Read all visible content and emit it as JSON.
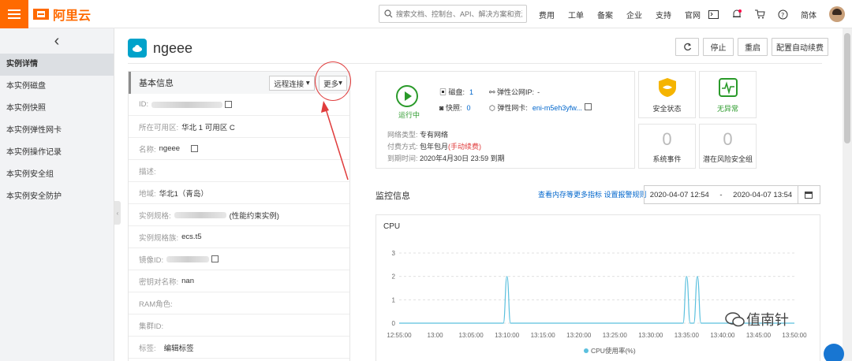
{
  "topbar": {
    "logo_text": "阿里云",
    "search_placeholder": "搜索文档、控制台、API、解决方案和资源",
    "nav": [
      "费用",
      "工单",
      "备案",
      "企业",
      "支持",
      "官网"
    ],
    "lang": "简体",
    "brand_color": "#ff6a00"
  },
  "sidebar": {
    "items": [
      "实例详情",
      "本实例磁盘",
      "本实例快照",
      "本实例弹性网卡",
      "本实例操作记录",
      "本实例安全组",
      "本实例安全防护"
    ]
  },
  "header": {
    "instance_name": "ngeee",
    "buttons": [
      "停止",
      "重启",
      "配置自动续费"
    ]
  },
  "basic": {
    "title": "基本信息",
    "remote_btn": "远程连接",
    "more_btn": "更多",
    "rows": [
      {
        "k": "ID:",
        "v": ""
      },
      {
        "k": "所在可用区:",
        "v": "华北 1 可用区 C"
      },
      {
        "k": "名称:",
        "v": "ngeee"
      },
      {
        "k": "描述:",
        "v": ""
      },
      {
        "k": "地域:",
        "v": "华北1（青岛）"
      },
      {
        "k": "实例规格:",
        "v": "(性能约束实例)"
      },
      {
        "k": "实例规格族:",
        "v": "ecs.t5"
      },
      {
        "k": "镜像ID:",
        "v": ""
      },
      {
        "k": "密钥对名称:",
        "v": "nan"
      },
      {
        "k": "RAM角色:",
        "v": ""
      },
      {
        "k": "集群ID:",
        "v": ""
      },
      {
        "k": "标签:",
        "v": "编辑标签"
      }
    ]
  },
  "status": {
    "running": "运行中",
    "disk_label": "磁盘:",
    "disk_count": "1",
    "snapshot_label": "快照:",
    "snapshot_count": "0",
    "eip_label": "弹性公网IP:",
    "eip_value": "-",
    "eni_label": "弹性网卡:",
    "eni_value": "eni-m5eh3yfw...",
    "net_type_k": "网络类型:",
    "net_type_v": "专有网络",
    "pay_k": "付费方式:",
    "pay_v": "包年包月",
    "pay_note": "(手动续费)",
    "expire_k": "到期时间:",
    "expire_v": "2020年4月30日 23:59 到期"
  },
  "cards": {
    "security": "安全状态",
    "abnormal": "无异常",
    "events_count": "0",
    "events_label": "系统事件",
    "risk_count": "0",
    "risk_label": "潜在风险安全组"
  },
  "monitor": {
    "title": "监控信息",
    "link1": "查看内存等更多指标",
    "link2": "设置报警规则",
    "start": "2020-04-07 12:54",
    "sep": "-",
    "end": "2020-04-07 13:54"
  },
  "chart_data": {
    "type": "line",
    "title": "CPU",
    "categories": [
      "12:55:00",
      "13:00",
      "13:05:00",
      "13:10:00",
      "13:15:00",
      "13:20:00",
      "13:25:00",
      "13:30:00",
      "13:35:00",
      "13:40:00",
      "13:45:00",
      "13:50:00"
    ],
    "y_ticks": [
      0,
      1,
      2,
      3
    ],
    "ylim": [
      0,
      3
    ],
    "series": [
      {
        "name": "CPU使用率(%)",
        "color": "#5bc0de",
        "points": [
          [
            0,
            0
          ],
          [
            29,
            0
          ],
          [
            30,
            2
          ],
          [
            31,
            0
          ],
          [
            79,
            0
          ],
          [
            80,
            2
          ],
          [
            81,
            0
          ],
          [
            82,
            0
          ],
          [
            83,
            2
          ],
          [
            84,
            0
          ],
          [
            110,
            0
          ]
        ]
      }
    ]
  },
  "watermark": "值南针"
}
